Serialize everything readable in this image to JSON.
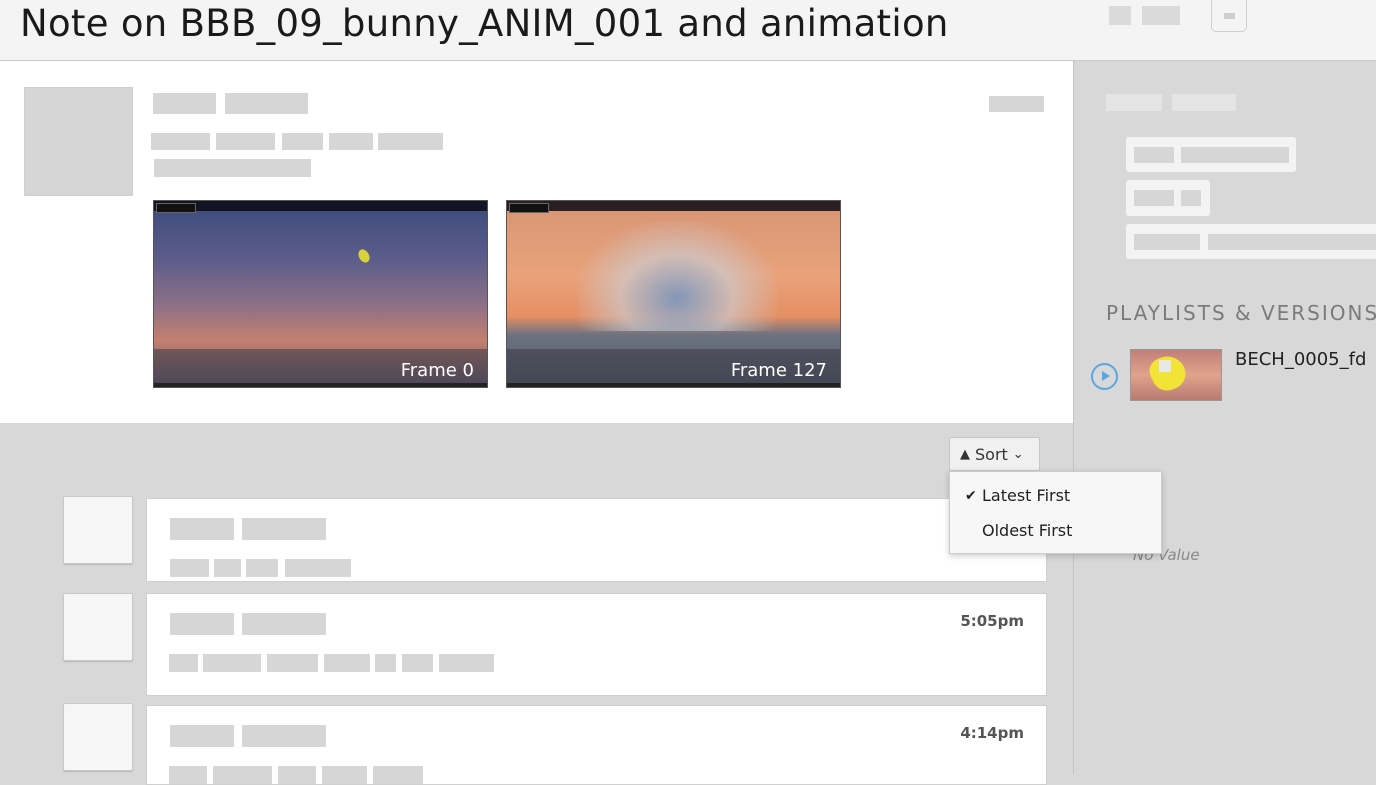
{
  "header": {
    "title": "Note on BBB_09_bunny_ANIM_001 and animation"
  },
  "note": {
    "thumbnails": [
      {
        "label": "Frame 0"
      },
      {
        "label": "Frame 127"
      }
    ]
  },
  "comments": {
    "sort_label": "Sort",
    "sort_options": [
      {
        "label": "Latest First",
        "selected": true
      },
      {
        "label": "Oldest First",
        "selected": false
      }
    ],
    "items": [
      {
        "time": ""
      },
      {
        "time": "5:05pm"
      },
      {
        "time": "4:14pm"
      }
    ]
  },
  "sidebar": {
    "section_title": "PLAYLISTS & VERSIONS",
    "version_name": "BECH_0005_fd",
    "empty_value": "No Value"
  },
  "colors": {
    "accent": "#5aa6e0",
    "placeholder": "#d6d6d6",
    "panel": "#ffffff",
    "background": "#d8d8d8"
  }
}
